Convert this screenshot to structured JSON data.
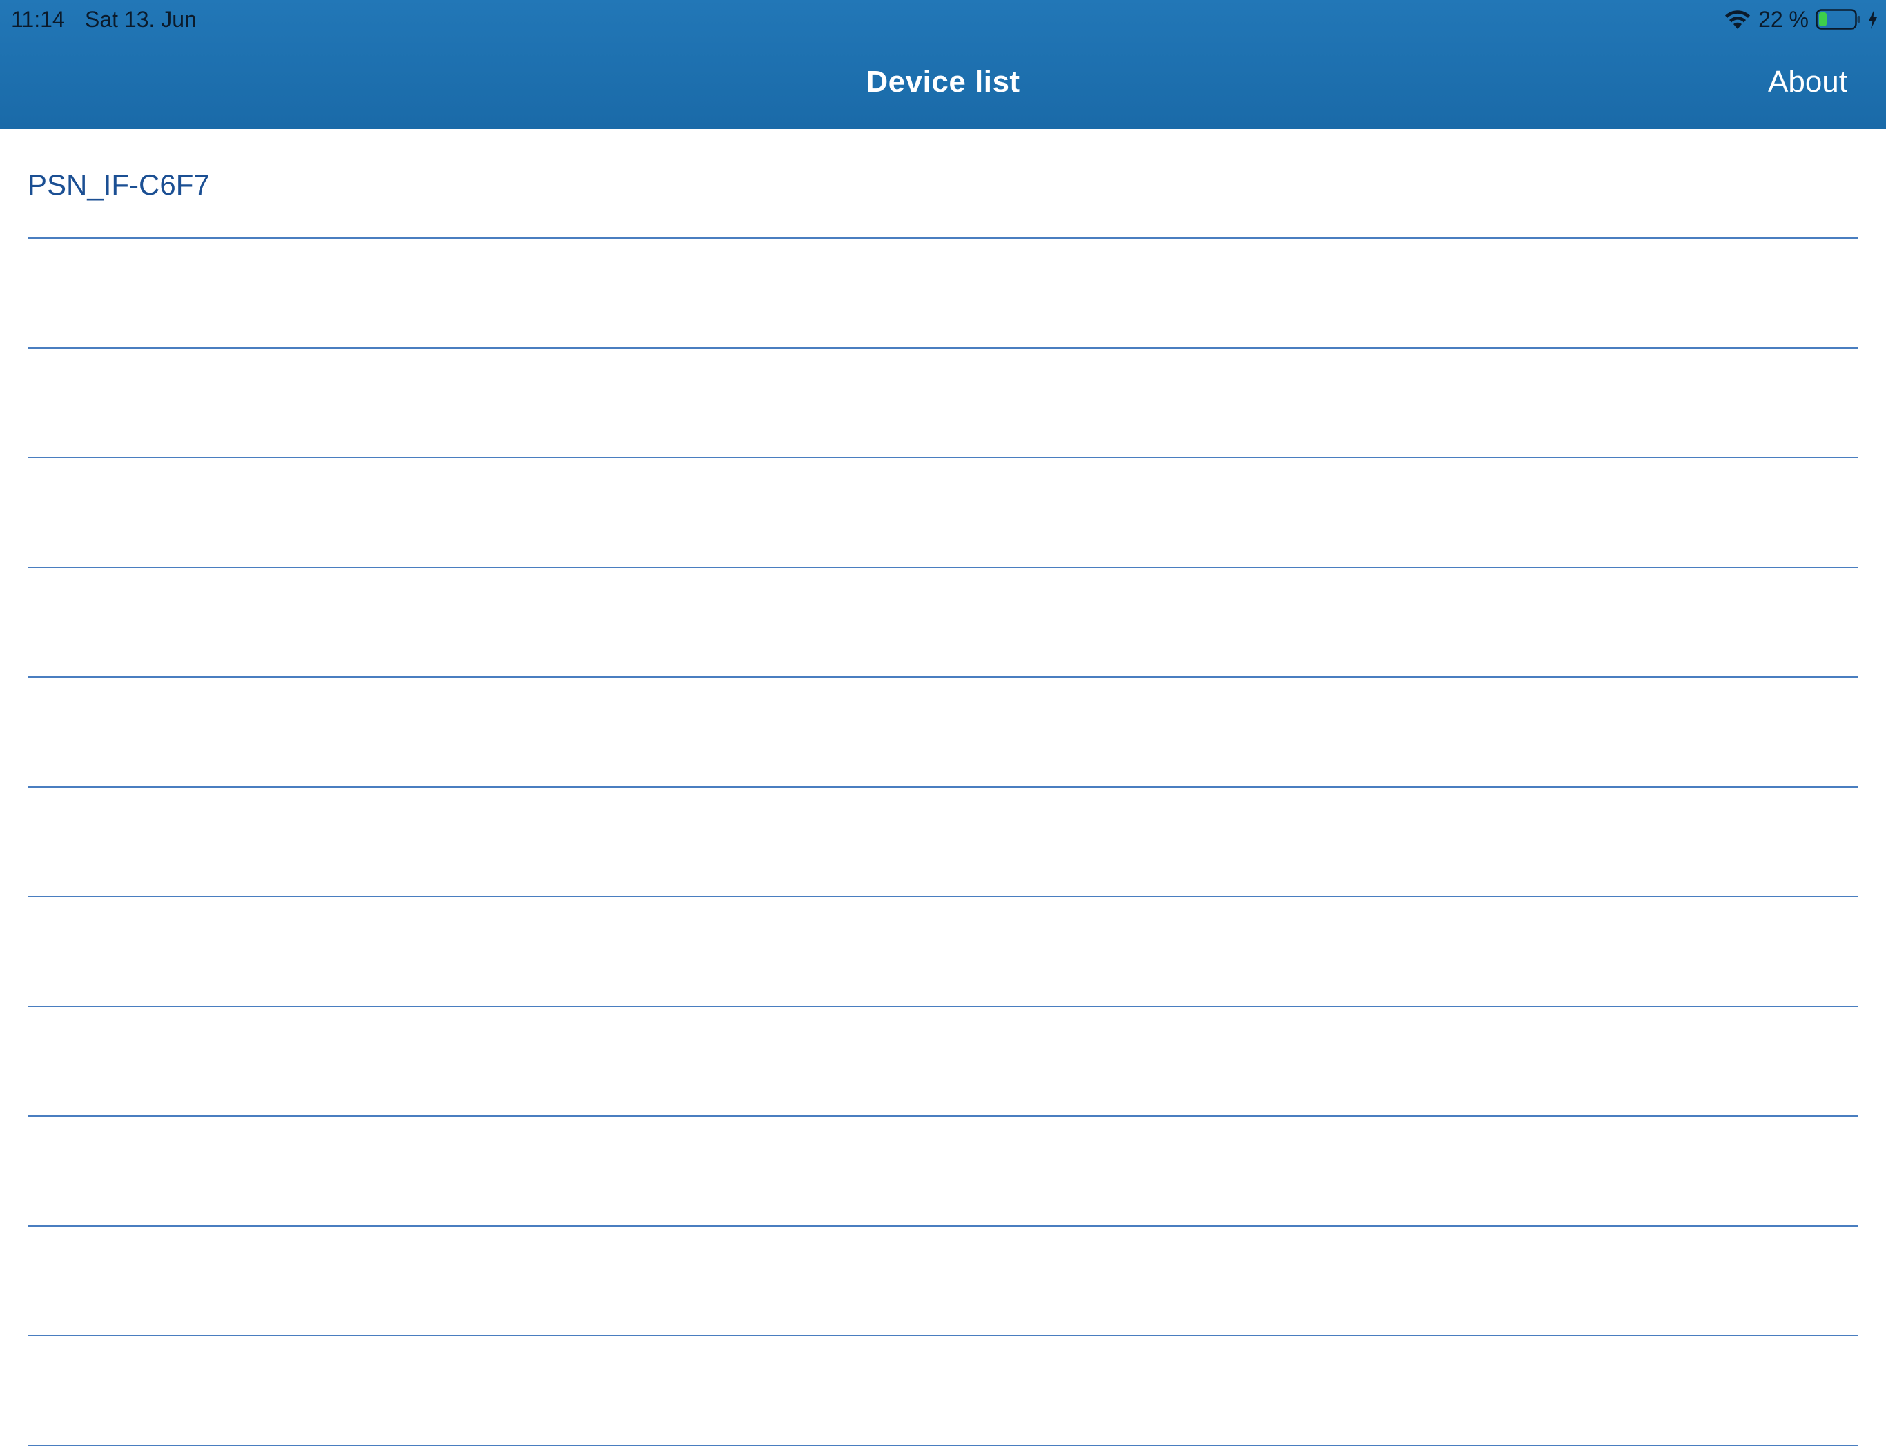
{
  "status_bar": {
    "time": "11:14",
    "date": "Sat 13. Jun",
    "battery_percent": "22 %",
    "battery_level": 0.22,
    "icons": [
      "wifi-icon",
      "battery-icon",
      "charging-bolt-icon"
    ]
  },
  "nav_bar": {
    "title": "Device list",
    "about_label": "About"
  },
  "device_list": {
    "items": [
      {
        "label": "PSN_IF-C6F7"
      },
      {
        "label": ""
      },
      {
        "label": ""
      },
      {
        "label": ""
      },
      {
        "label": ""
      },
      {
        "label": ""
      },
      {
        "label": ""
      },
      {
        "label": ""
      },
      {
        "label": ""
      },
      {
        "label": ""
      },
      {
        "label": ""
      },
      {
        "label": ""
      }
    ]
  },
  "colors": {
    "header_top": "#2277b7",
    "header_bottom": "#1a6aa8",
    "list_text": "#1b4f93",
    "separator": "#4a7ec0",
    "battery_fill": "#3ecf4a"
  }
}
